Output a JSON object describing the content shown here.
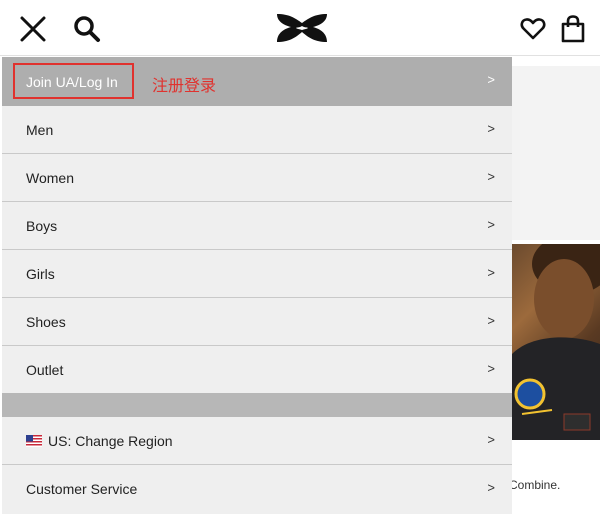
{
  "header": {
    "close_icon": "close-icon",
    "search_icon": "search-icon",
    "logo_icon": "under-armour-logo",
    "wishlist_icon": "heart-icon",
    "bag_icon": "shopping-bag-icon"
  },
  "menu": {
    "login_label": "Join UA/Log In",
    "login_note": "注册登录",
    "chevron": ">",
    "items": [
      {
        "label": "Men"
      },
      {
        "label": "Women"
      },
      {
        "label": "Boys"
      },
      {
        "label": "Girls"
      },
      {
        "label": "Shoes"
      },
      {
        "label": "Outlet"
      }
    ],
    "region_label": "US: Change Region",
    "customer_service_label": "Customer Service"
  },
  "background": {
    "caption": "Combine."
  },
  "colors": {
    "login_bg": "#aeaeae",
    "menu_bg": "#efefef",
    "highlight": "#e0322e"
  }
}
